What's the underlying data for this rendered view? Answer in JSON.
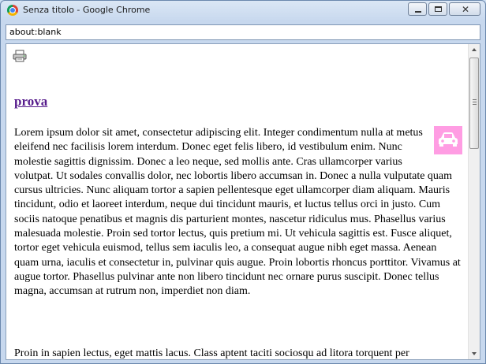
{
  "window": {
    "title": "Senza titolo - Google Chrome",
    "controls": {
      "minimize": "minimize",
      "maximize": "maximize",
      "close": "close"
    }
  },
  "address": {
    "url": "about:blank"
  },
  "page": {
    "print_icon": "printer-icon",
    "heading": "prova",
    "image": {
      "icon": "car-icon",
      "background": "#ff9de3"
    },
    "paragraph1": "Lorem ipsum dolor sit amet, consectetur adipiscing elit. Integer condimentum nulla at metus eleifend nec facilisis lorem interdum. Donec eget felis libero, id vestibulum enim. Nunc molestie sagittis dignissim. Donec a leo neque, sed mollis ante. Cras ullamcorper varius volutpat. Ut sodales convallis dolor, nec lobortis libero accumsan in. Donec a nulla vulputate quam cursus ultricies. Nunc aliquam tortor a sapien pellentesque eget ullamcorper diam aliquam. Mauris tincidunt, odio et laoreet interdum, neque dui tincidunt mauris, et luctus tellus orci in justo. Cum sociis natoque penatibus et magnis dis parturient montes, nascetur ridiculus mus. Phasellus varius malesuada molestie. Proin sed tortor lectus, quis pretium mi. Ut vehicula sagittis est. Fusce aliquet, tortor eget vehicula euismod, tellus sem iaculis leo, a consequat augue nibh eget massa. Aenean quam urna, iaculis et consectetur in, pulvinar quis augue. Proin lobortis rhoncus porttitor. Vivamus at augue tortor. Phasellus pulvinar ante non libero tincidunt nec ornare purus suscipit. Donec tellus magna, accumsan at rutrum non, imperdiet non diam.",
    "paragraph2": "Proin in sapien lectus, eget mattis lacus. Class aptent taciti sociosqu ad litora torquent per"
  }
}
